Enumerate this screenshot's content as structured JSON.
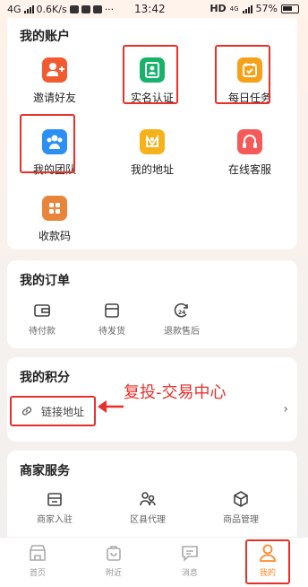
{
  "status_bar": {
    "network": "4G",
    "speed": "0.6K/s",
    "time": "13:42",
    "hd": "HD",
    "network_right": "4G",
    "battery": "57%"
  },
  "account": {
    "title": "我的账户",
    "items": [
      {
        "label": "邀请好友",
        "icon": "add-user-icon",
        "color": "#f25a30"
      },
      {
        "label": "实名认证",
        "icon": "id-card-icon",
        "color": "#17b36a"
      },
      {
        "label": "每日任务",
        "icon": "calendar-check-icon",
        "color": "#f7a11a"
      },
      {
        "label": "我的团队",
        "icon": "team-icon",
        "color": "#2b8ff3"
      },
      {
        "label": "我的地址",
        "icon": "location-icon",
        "color": "#f6b21b"
      },
      {
        "label": "在线客服",
        "icon": "headset-icon",
        "color": "#f45a5a"
      },
      {
        "label": "收款码",
        "icon": "grid-icon",
        "color": "#e9853a"
      }
    ]
  },
  "orders": {
    "title": "我的订单",
    "items": [
      {
        "label": "待付款",
        "icon": "wallet-icon"
      },
      {
        "label": "待发货",
        "icon": "box-icon"
      },
      {
        "label": "退款售后",
        "icon": "refund-24-icon"
      }
    ]
  },
  "points": {
    "title": "我的积分",
    "link_label": "链接地址",
    "annotation": "复投-交易中心"
  },
  "merchant": {
    "title": "商家服务",
    "items": [
      {
        "label": "商家入驻",
        "icon": "store-icon"
      },
      {
        "label": "区县代理",
        "icon": "people-icon"
      },
      {
        "label": "商品管理",
        "icon": "cube-icon"
      }
    ]
  },
  "tabbar": {
    "items": [
      {
        "label": "首页",
        "icon": "home-shop-icon"
      },
      {
        "label": "附近",
        "icon": "bag-icon"
      },
      {
        "label": "消息",
        "icon": "chat-icon"
      },
      {
        "label": "我的",
        "icon": "user-icon",
        "active": true
      }
    ]
  }
}
